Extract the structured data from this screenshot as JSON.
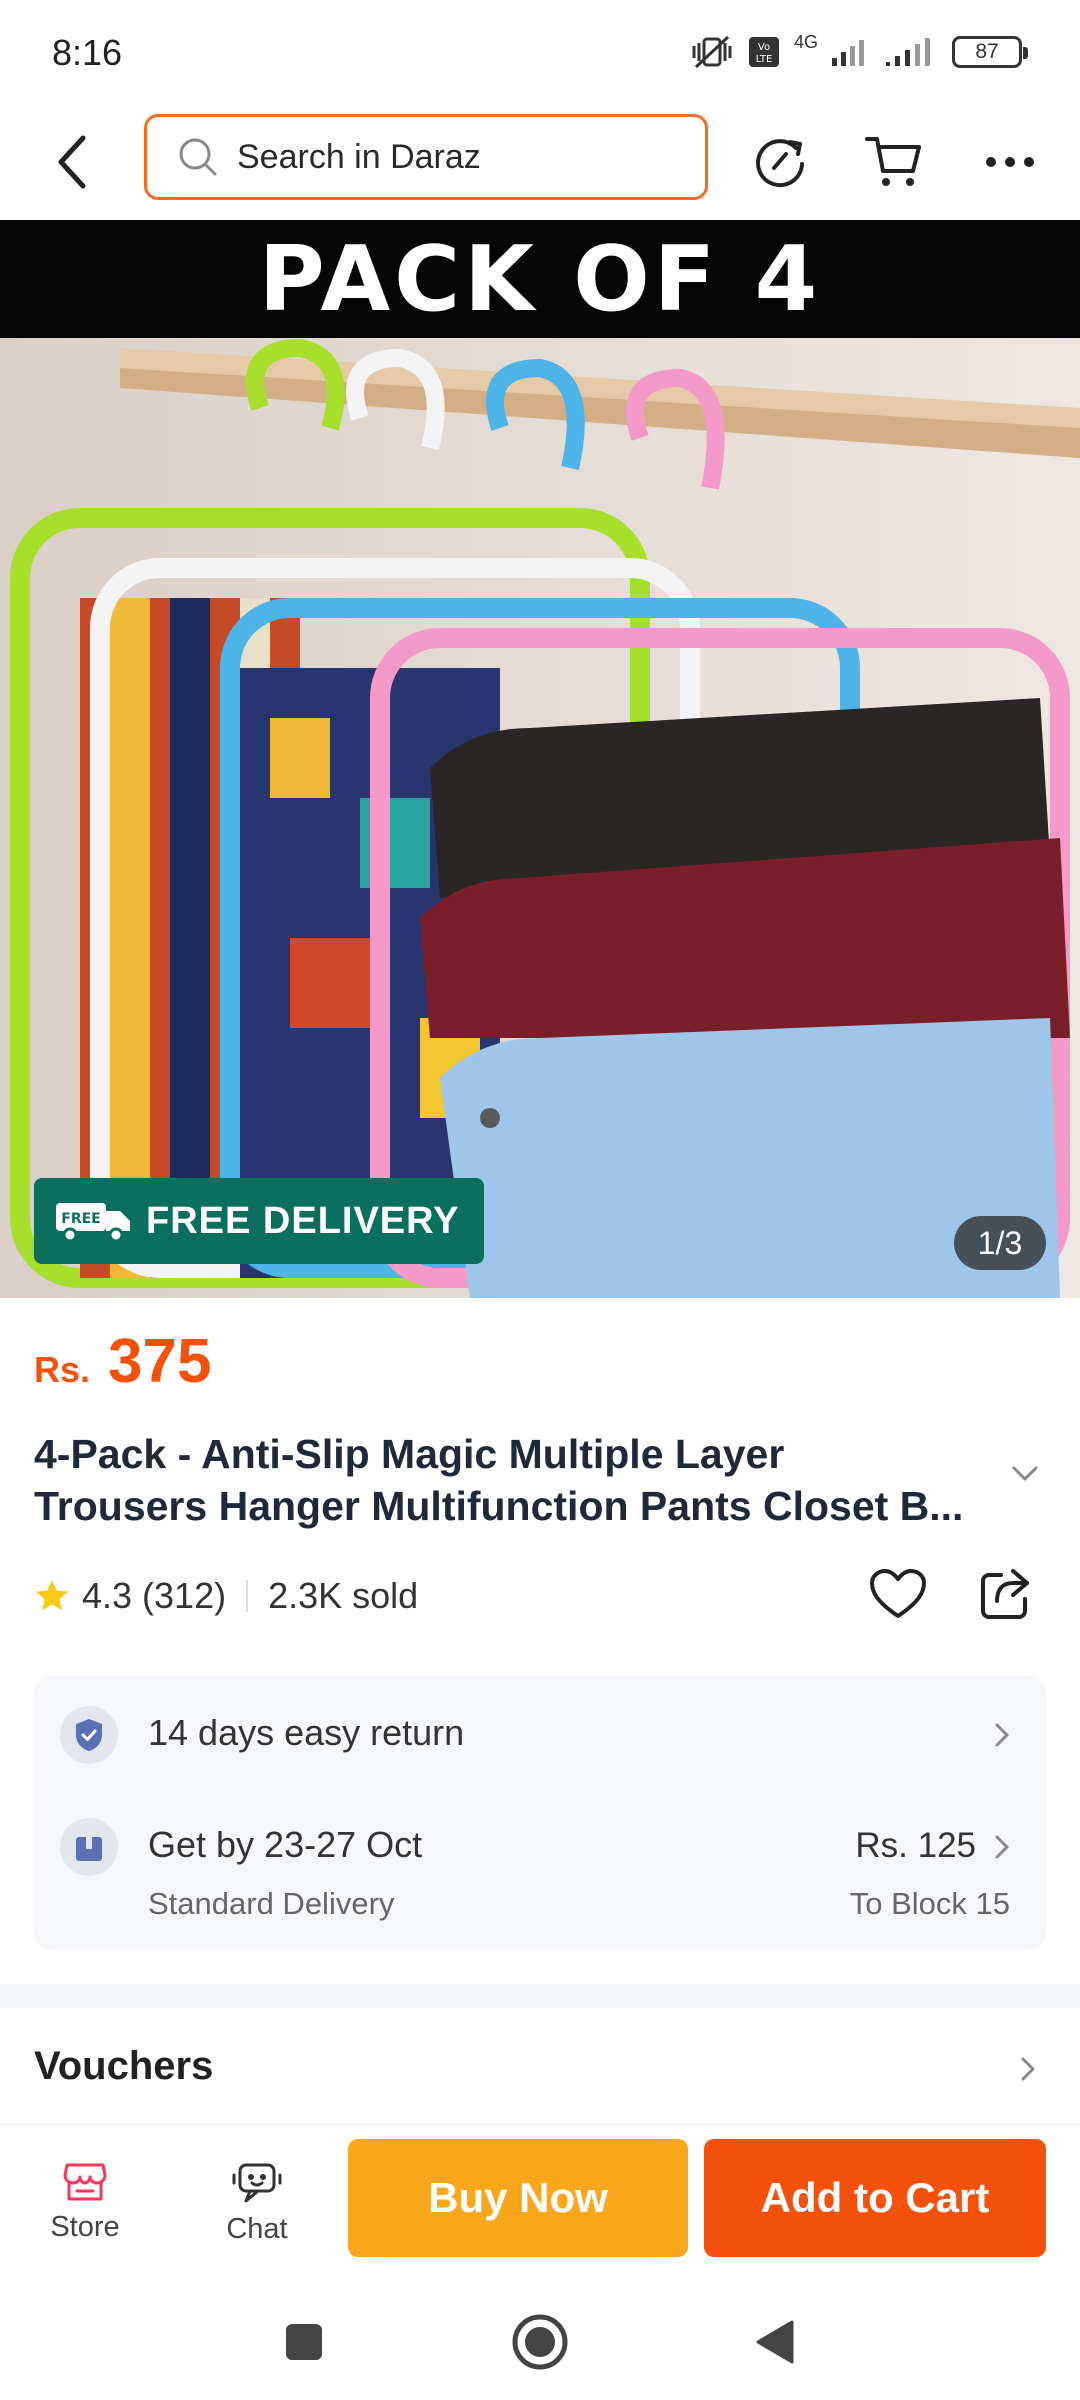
{
  "status_bar": {
    "time": "8:16",
    "battery": "87",
    "network": "4G"
  },
  "search": {
    "placeholder": "Search in Daraz"
  },
  "hero": {
    "banner_text": "PACK OF 4",
    "badge_icon_text": "FREE",
    "badge_text": "FREE DELIVERY",
    "counter": "1/3"
  },
  "product": {
    "currency": "Rs.",
    "price": "375",
    "title_line1": "4-Pack - Anti-Slip Magic Multiple Layer",
    "title_line2": "Trousers Hanger Multifunction Pants Closet B...",
    "rating": "4.3",
    "reviews": "(312)",
    "sold": "2.3K sold"
  },
  "services": {
    "return_text": "14 days easy return",
    "delivery_title": "Get by 23-27 Oct",
    "delivery_type": "Standard Delivery",
    "delivery_fee": "Rs. 125",
    "delivery_destination": "To Block 15"
  },
  "vouchers": {
    "title": "Vouchers"
  },
  "action_bar": {
    "store_label": "Store",
    "chat_label": "Chat",
    "buy_now_label": "Buy Now",
    "add_to_cart_label": "Add to Cart"
  },
  "colors": {
    "brand_orange": "#f4510c",
    "buy_now": "#fba71b",
    "delivery_badge": "#0c6e5c",
    "search_border": "#f36c21"
  }
}
